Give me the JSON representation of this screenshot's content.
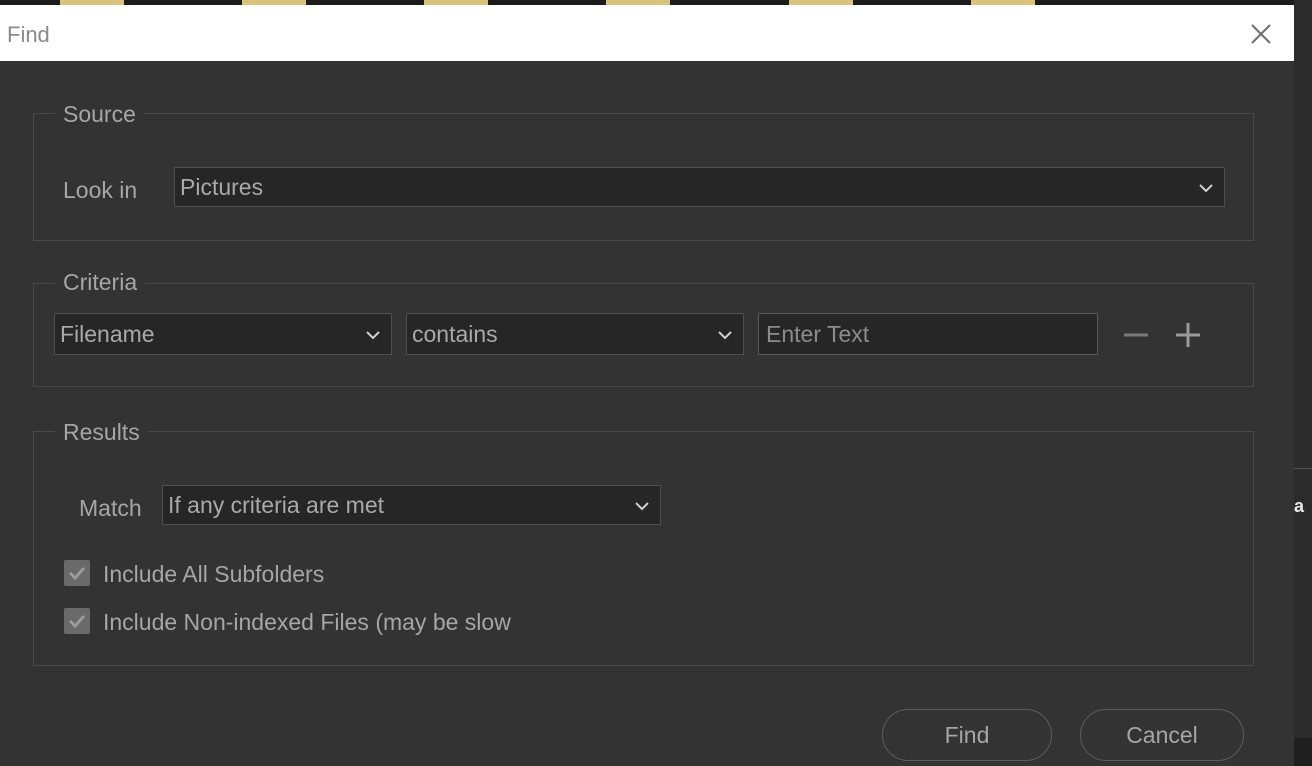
{
  "background": {
    "right_panel_letter": "a"
  },
  "dialog": {
    "title": "Find",
    "source": {
      "group_label": "Source",
      "look_in_label": "Look in",
      "look_in_value": "Pictures"
    },
    "criteria": {
      "group_label": "Criteria",
      "field_value": "Filename",
      "operator_value": "contains",
      "text_placeholder": "Enter Text"
    },
    "results": {
      "group_label": "Results",
      "match_label": "Match",
      "match_value": "If any criteria are met",
      "include_subfolders_label": "Include All Subfolders",
      "include_subfolders_checked": true,
      "include_nonindexed_label": "Include Non-indexed Files (may be slow",
      "include_nonindexed_checked": true
    },
    "buttons": {
      "find_label": "Find",
      "cancel_label": "Cancel"
    }
  },
  "colors": {
    "dialog_bg": "#333333",
    "titlebar_bg": "#ffffff",
    "field_bg": "#262626",
    "text": "#a6a6a6"
  }
}
